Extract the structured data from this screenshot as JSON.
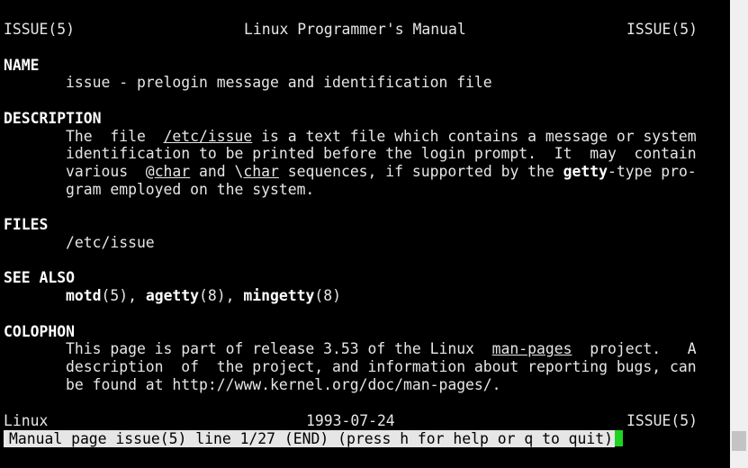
{
  "header": {
    "left": "ISSUE(5)",
    "center": "Linux Programmer's Manual",
    "right": "ISSUE(5)"
  },
  "sections": {
    "name": {
      "heading": "NAME",
      "text": "issue - prelogin message and identification file"
    },
    "description": {
      "heading": "DESCRIPTION",
      "l1_a": "The  file  ",
      "l1_file": "/etc/issue",
      "l1_b": " is a text file which contains a message or system",
      "l2": "identification to be printed before the login prompt.  It  may  contain",
      "l3_a": "various  @",
      "l3_char1": "char",
      "l3_b": " and \\",
      "l3_char2": "char",
      "l3_c": " sequences, if supported by the ",
      "l3_getty": "getty",
      "l3_d": "-type pro-",
      "l4": "gram employed on the system."
    },
    "files": {
      "heading": "FILES",
      "text": "/etc/issue"
    },
    "see_also": {
      "heading": "SEE ALSO",
      "motd": "motd",
      "motd_sec": "(5), ",
      "agetty": "agetty",
      "agetty_sec": "(8), ",
      "mingetty": "mingetty",
      "mingetty_sec": "(8)"
    },
    "colophon": {
      "heading": "COLOPHON",
      "l1_a": "This page is part of release 3.53 of the Linux  ",
      "l1_link": "man-pages",
      "l1_b": "  project.   A",
      "l2": "description  of  the project, and information about reporting bugs, can",
      "l3": "be found at http://www.kernel.org/doc/man-pages/."
    }
  },
  "footer": {
    "left": "Linux",
    "center": "1993-07-24",
    "right": "ISSUE(5)"
  },
  "status_bar": {
    "text": "Manual page issue(5) line 1/27 (END) (press h for help or q to quit)"
  },
  "colors": {
    "background": "#000000",
    "foreground": "#e6e6e6",
    "cursor": "#1ed41e",
    "status_bg": "#e6e6e6"
  }
}
